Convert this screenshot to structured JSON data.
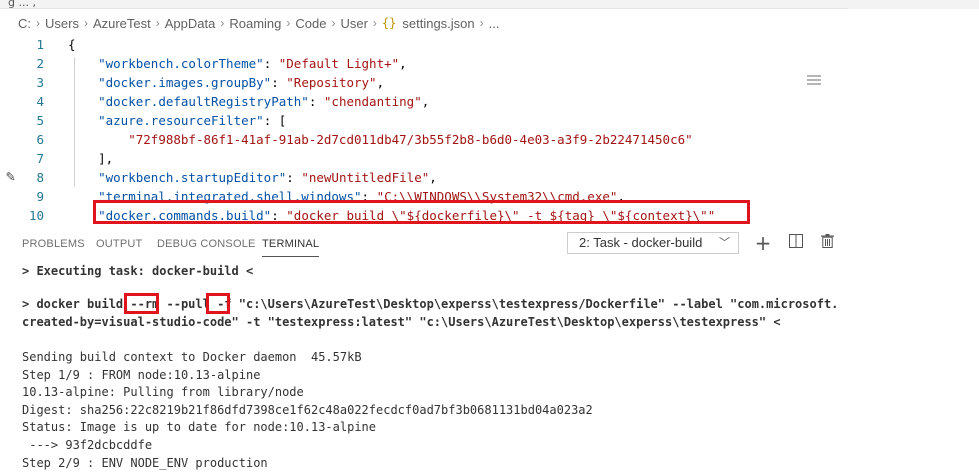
{
  "top_tab_fragment": "g ... ,",
  "breadcrumb": [
    "C:",
    "Users",
    "AzureTest",
    "AppData",
    "Roaming",
    "Code",
    "User",
    "settings.json",
    "..."
  ],
  "breadcrumb_file_icon": "{}",
  "editor": {
    "lines": [
      {
        "n": "1",
        "t": "{"
      },
      {
        "n": "2",
        "k": "\"workbench.colorTheme\"",
        "v": "\"Default Light+\"",
        "end": ","
      },
      {
        "n": "3",
        "k": "\"docker.images.groupBy\"",
        "v": "\"Repository\"",
        "end": ","
      },
      {
        "n": "4",
        "k": "\"docker.defaultRegistryPath\"",
        "v": "\"chendanting\"",
        "end": ","
      },
      {
        "n": "5",
        "k": "\"azure.resourceFilter\"",
        "v": "",
        "end": "["
      },
      {
        "n": "6",
        "v2": "\"72f988bf-86f1-41af-91ab-2d7cd011db47/3b55f2b8-b6d0-4e03-a3f9-2b22471450c6\""
      },
      {
        "n": "7",
        "t": "    ],"
      },
      {
        "n": "8",
        "k": "\"workbench.startupEditor\"",
        "v": "\"newUntitledFile\"",
        "end": ","
      },
      {
        "n": "9",
        "k": "\"terminal.integrated.shell.windows\"",
        "v": "\"C:\\\\WINDOWS\\\\System32\\\\cmd.exe\"",
        "end": ","
      },
      {
        "n": "10",
        "k": "\"docker.commands.build\"",
        "v": "\"docker build \\\"${dockerfile}\\\" -t ${tag} \\\"${context}\\\"\"",
        "end": ""
      }
    ]
  },
  "panel": {
    "tabs": [
      "PROBLEMS",
      "OUTPUT",
      "DEBUG CONSOLE",
      "TERMINAL"
    ],
    "active_tab": "TERMINAL",
    "task_select": "2: Task - docker-build",
    "icons": [
      "plus-icon",
      "split-icon",
      "trash-icon"
    ]
  },
  "terminal": {
    "executing": "> Executing task: docker-build <",
    "cmd_prefix": "> docker build ",
    "cmd_rm": "--rm",
    "cmd_mid": " --pull ",
    "cmd_f": "-f",
    "cmd_rest1": " \"c:\\Users\\AzureTest\\Desktop\\experss\\testexpress/Dockerfile\" --label \"com.microsoft.",
    "cmd_rest2": "created-by=visual-studio-code\" -t \"testexpress:latest\" \"c:\\Users\\AzureTest\\Desktop\\experss\\testexpress\" <",
    "output": [
      "Sending build context to Docker daemon  45.57kB",
      "Step 1/9 : FROM node:10.13-alpine",
      "10.13-alpine: Pulling from library/node",
      "Digest: sha256:22c8219b21f86dfd7398ce1f62c48a022fecdcf0ad7bf3b0681131bd04a023a2",
      "Status: Image is up to date for node:10.13-alpine",
      " ---> 93f2dcbcddfe",
      "Step 2/9 : ENV NODE_ENV production"
    ]
  },
  "colors": {
    "highlight": "#e0141d",
    "key": "#0451a5",
    "string": "#a31515",
    "line_number": "#237893"
  }
}
